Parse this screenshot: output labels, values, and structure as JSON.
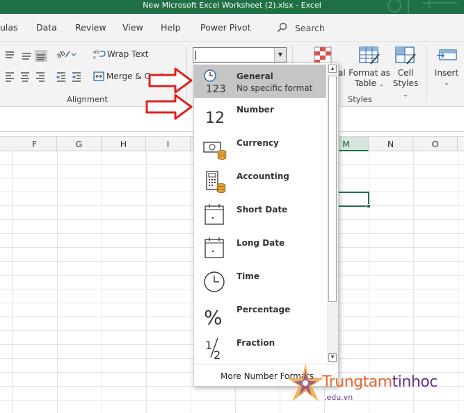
{
  "window": {
    "title": "New Microsoft Excel Worksheet (2).xlsx  -  Excel"
  },
  "tabs": [
    "ulas",
    "Data",
    "Review",
    "View",
    "Help",
    "Power Pivot"
  ],
  "tell_me": {
    "label": "Search"
  },
  "ribbon": {
    "wrap_text": "Wrap Text",
    "merge_center": "Merge & Center",
    "alignment_label": "Alignment",
    "conditional_partial": "al",
    "format_as_table_line1": "Format as",
    "format_as_table_line2": "Table",
    "cell_styles_line1": "Cell",
    "cell_styles_line2": "Styles",
    "styles_label": "Styles",
    "insert": "Insert"
  },
  "number_format_box": {
    "value": ""
  },
  "columns": [
    "F",
    "G",
    "H",
    "I",
    "M",
    "N",
    "O"
  ],
  "selected_column": "M",
  "dropdown": {
    "items": [
      {
        "label": "General",
        "sub": "No specific format",
        "icon": "clock-123-icon",
        "selected": true
      },
      {
        "label": "Number",
        "icon": "number-12-icon"
      },
      {
        "label": "Currency",
        "icon": "currency-icon"
      },
      {
        "label": "Accounting",
        "icon": "accounting-icon"
      },
      {
        "label": "Short Date",
        "icon": "calendar-icon"
      },
      {
        "label": "Long Date",
        "icon": "calendar-icon"
      },
      {
        "label": "Time",
        "icon": "clock-icon"
      },
      {
        "label": "Percentage",
        "icon": "percent-icon"
      },
      {
        "label": "Fraction",
        "icon": "fraction-icon"
      }
    ],
    "icon_text": {
      "general": "123",
      "number": "12",
      "percent": "%"
    },
    "more": "More Number Formats..."
  },
  "watermark": {
    "brand_a": "Trungtam",
    "brand_b": "tinhoc",
    "domain": ".edu.vn"
  },
  "colors": {
    "excel_green": "#1f7145",
    "arrow_red": "#e0201e"
  }
}
